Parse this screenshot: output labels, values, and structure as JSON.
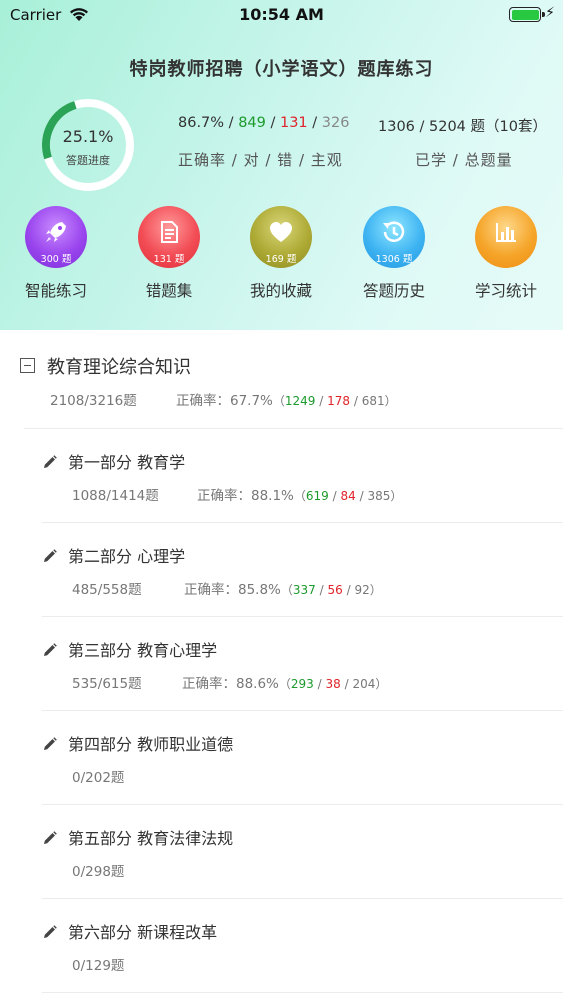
{
  "status_bar": {
    "carrier": "Carrier",
    "time": "10:54 AM"
  },
  "app_title": "特岗教师招聘（小学语文）题库练习",
  "progress": {
    "percent_text": "25.1%",
    "label": "答题进度",
    "fraction": 0.251
  },
  "accuracy_stats": {
    "rate": "86.7%",
    "sep": " / ",
    "correct": "849",
    "wrong": "131",
    "subjective": "326",
    "caption": "正确率 / 对 / 错 / 主观"
  },
  "done_stats": {
    "value": "1306 / 5204 题（10套）",
    "caption": "已学 / 总题量"
  },
  "actions": [
    {
      "label": "智能练习",
      "count": "300 题",
      "icon": "rocket-icon"
    },
    {
      "label": "错题集",
      "count": "131 题",
      "icon": "document-icon"
    },
    {
      "label": "我的收藏",
      "count": "169 题",
      "icon": "heart-icon"
    },
    {
      "label": "答题历史",
      "count": "1306 题",
      "icon": "history-icon"
    },
    {
      "label": "学习统计",
      "count": "",
      "icon": "bar-chart-icon"
    }
  ],
  "colors": {
    "accent_green": "#1c9a2c",
    "error_red": "#e0242b",
    "ring_track": "#ffffff",
    "ring_progress": "#2aa356"
  },
  "section": {
    "title": "教育理论综合知识",
    "count": "2108/3216题",
    "rate_label": "正确率：67.7%",
    "paren_open": "（",
    "correct": "1249",
    "wrong": "178",
    "subjective": "681",
    "paren_close": "）",
    "slash": " / "
  },
  "parts": [
    {
      "title": "第一部分 教育学",
      "count": "1088/1414题",
      "rate_label": "正确率：88.1%",
      "paren_open": "（",
      "correct": "619",
      "wrong": "84",
      "subjective": "385",
      "paren_close": "）",
      "slash": " / "
    },
    {
      "title": "第二部分 心理学",
      "count": "485/558题",
      "rate_label": "正确率：85.8%",
      "paren_open": "（",
      "correct": "337",
      "wrong": "56",
      "subjective": "92",
      "paren_close": "）",
      "slash": " / "
    },
    {
      "title": "第三部分 教育心理学",
      "count": "535/615题",
      "rate_label": "正确率：88.6%",
      "paren_open": "（",
      "correct": "293",
      "wrong": "38",
      "subjective": "204",
      "paren_close": "）",
      "slash": " / "
    },
    {
      "title": "第四部分 教师职业道德",
      "count": "0/202题"
    },
    {
      "title": "第五部分 教育法律法规",
      "count": "0/298题"
    },
    {
      "title": "第六部分 新课程改革",
      "count": "0/129题"
    }
  ]
}
